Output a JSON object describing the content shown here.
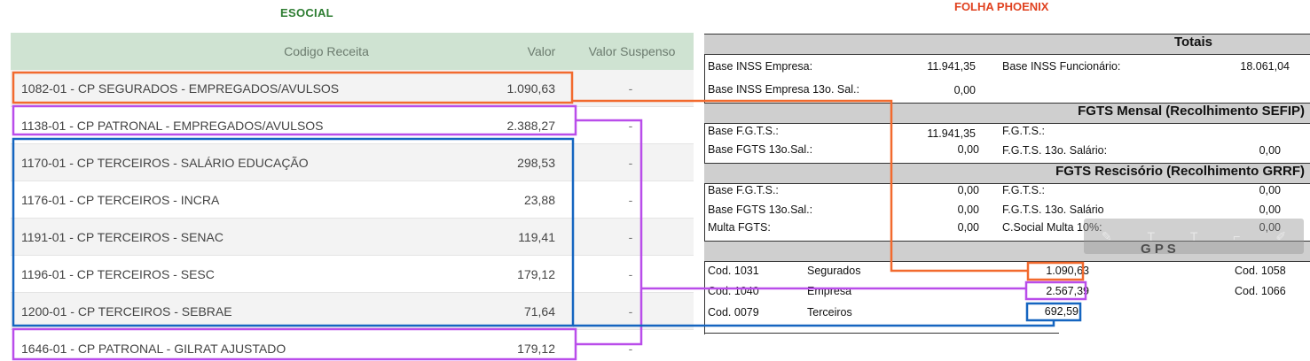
{
  "esocial": {
    "title": "ESOCIAL",
    "headers": {
      "code": "Codigo Receita",
      "valor": "Valor",
      "suspenso": "Valor Suspenso"
    },
    "rows": [
      {
        "code": "1082-01 - CP SEGURADOS - EMPREGADOS/AVULSOS",
        "valor": "1.090,63",
        "suspenso": "-"
      },
      {
        "code": "1138-01 - CP PATRONAL - EMPREGADOS/AVULSOS",
        "valor": "2.388,27",
        "suspenso": "-"
      },
      {
        "code": "1170-01 - CP TERCEIROS - SALÁRIO EDUCAÇÃO",
        "valor": "298,53",
        "suspenso": "-"
      },
      {
        "code": "1176-01 - CP TERCEIROS - INCRA",
        "valor": "23,88",
        "suspenso": "-"
      },
      {
        "code": "1191-01 - CP TERCEIROS - SENAC",
        "valor": "119,41",
        "suspenso": "-"
      },
      {
        "code": "1196-01 - CP TERCEIROS - SESC",
        "valor": "179,12",
        "suspenso": "-"
      },
      {
        "code": "1200-01 - CP TERCEIROS - SEBRAE",
        "valor": "71,64",
        "suspenso": "-"
      },
      {
        "code": "1646-01 - CP PATRONAL - GILRAT AJUSTADO",
        "valor": "179,12",
        "suspenso": "-"
      }
    ]
  },
  "phoenix": {
    "title": "FOLHA PHOENIX",
    "totais": {
      "heading": "Totais",
      "base_inss_empresa_label": "Base INSS Empresa:",
      "base_inss_empresa": "11.941,35",
      "base_inss_func_label": "Base INSS Funcionário:",
      "base_inss_func": "18.061,04",
      "base_inss_13_label": "Base INSS Empresa 13o. Sal.:",
      "base_inss_13": "0,00"
    },
    "fgts_mensal": {
      "heading": "FGTS Mensal (Recolhimento SEFIP)",
      "base_fgts_label": "Base F.G.T.S.:",
      "base_fgts": "11.941,35",
      "fgts_label": "F.G.T.S.:",
      "base_fgts13_label": "Base FGTS 13o.Sal.:",
      "base_fgts13": "0,00",
      "fgts13_label": "F.G.T.S. 13o. Salário:",
      "fgts13": "0,00"
    },
    "fgts_rescisorio": {
      "heading": "FGTS Rescisório (Recolhimento GRRF)",
      "base_fgts_label": "Base F.G.T.S.:",
      "base_fgts": "0,00",
      "fgts_label": "F.G.T.S.:",
      "fgts": "0,00",
      "base_fgts13_label": "Base FGTS 13o.Sal.:",
      "base_fgts13": "0,00",
      "fgts13_label": "F.G.T.S. 13o. Salário",
      "fgts13": "0,00",
      "multa_label": "Multa FGTS:",
      "multa": "0,00",
      "csocial_label": "C.Social Multa 10%:",
      "csocial": "0,00"
    },
    "gps": {
      "heading": "G P S",
      "rows": [
        {
          "cod": "Cod. 1031",
          "desc": "Segurados",
          "valor": "1.090,63",
          "cod_right": "Cod. 1058"
        },
        {
          "cod": "Cod. 1040",
          "desc": "Empresa",
          "valor": "2.567,39",
          "cod_right": "Cod. 1066"
        },
        {
          "cod": "Cod. 0079",
          "desc": "Terceiros",
          "valor": "692,59",
          "cod_right": ""
        }
      ]
    }
  },
  "annotation_colors": {
    "orange": "#f26a2e",
    "purple": "#b94dea",
    "blue": "#1565c0"
  }
}
